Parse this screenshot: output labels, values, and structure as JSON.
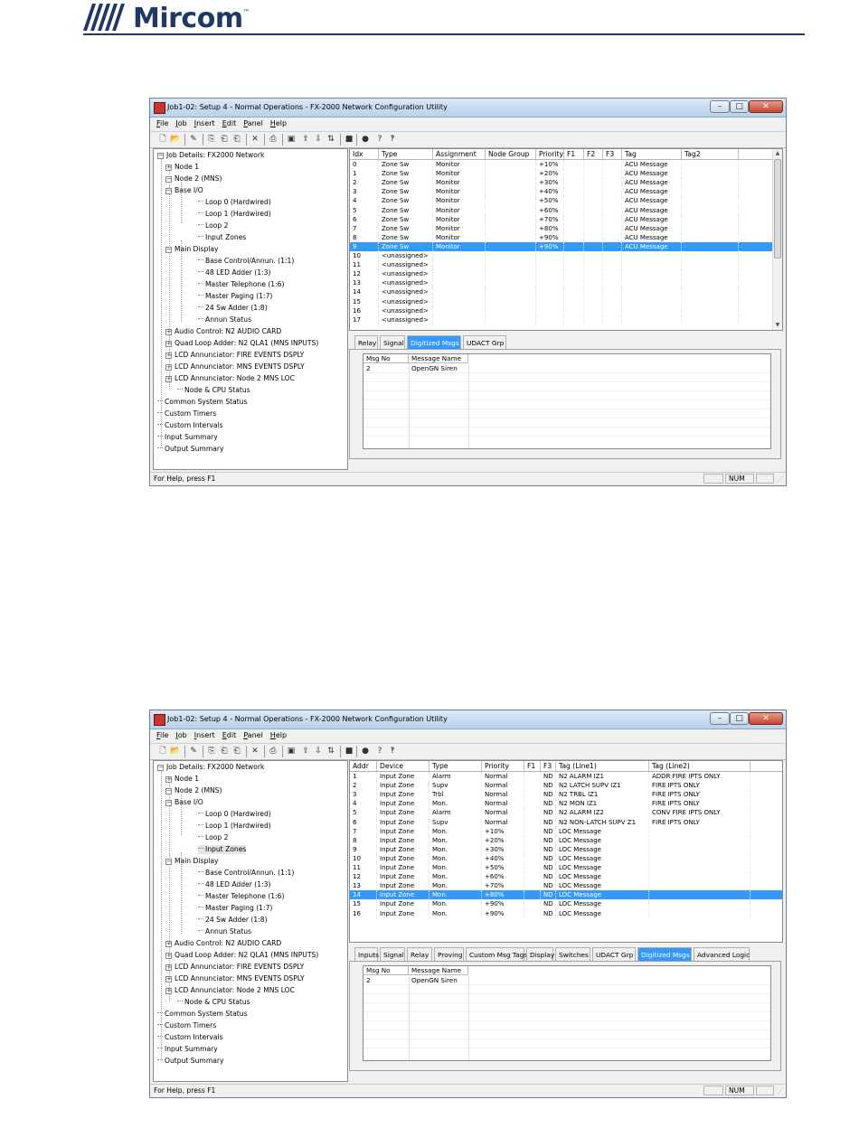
{
  "brand": {
    "name": "Mircom",
    "tm": "™",
    "color": "#1f3864"
  },
  "windows": [
    {
      "title": "Job1-02: Setup 4 - Normal Operations - FX-2000 Network Configuration Utility",
      "menu": [
        "File",
        "Job",
        "Insert",
        "Edit",
        "Panel",
        "Help"
      ],
      "tree": [
        "Job Details: FX2000 Network",
        "Node 1",
        "Node 2 (MNS)",
        "Base I/O",
        "Loop 0  (Hardwired)",
        "Loop 1  (Hardwired)",
        "Loop 2",
        "Input Zones",
        "Main Display",
        "Base Control/Annun. (1:1)",
        "48 LED Adder (1:3)",
        "Master Telephone (1:6)",
        "Master Paging (1:7)",
        "24 Sw Adder (1:8)",
        "Annun Status",
        "Audio Control: N2 AUDIO CARD",
        "Quad Loop Adder: N2 QLA1 (MNS INPUTS)",
        "LCD Annunciator: FIRE EVENTS DSPLY",
        "LCD Annunciator: MNS EVENTS DSPLY",
        "LCD Annunciator: Node 2 MNS LOC",
        "Node & CPU Status",
        "Common System Status",
        "Custom Timers",
        "Custom Intervals",
        "Input Summary",
        "Output Summary"
      ],
      "grid_headers": [
        "Idx",
        "Type",
        "Assignment",
        "Node Group",
        "Priority",
        "F1",
        "F2",
        "F3",
        "Tag",
        "Tag2"
      ],
      "grid_rows": [
        [
          "0",
          "Zone Sw",
          "Monitor",
          "",
          "+10%",
          "",
          "",
          "",
          "ACU Message",
          ""
        ],
        [
          "1",
          "Zone Sw",
          "Monitor",
          "",
          "+20%",
          "",
          "",
          "",
          "ACU Message",
          ""
        ],
        [
          "2",
          "Zone Sw",
          "Monitor",
          "",
          "+30%",
          "",
          "",
          "",
          "ACU Message",
          ""
        ],
        [
          "3",
          "Zone Sw",
          "Monitor",
          "",
          "+40%",
          "",
          "",
          "",
          "ACU Message",
          ""
        ],
        [
          "4",
          "Zone Sw",
          "Monitor",
          "",
          "+50%",
          "",
          "",
          "",
          "ACU Message",
          ""
        ],
        [
          "5",
          "Zone Sw",
          "Monitor",
          "",
          "+60%",
          "",
          "",
          "",
          "ACU Message",
          ""
        ],
        [
          "6",
          "Zone Sw",
          "Monitor",
          "",
          "+70%",
          "",
          "",
          "",
          "ACU Message",
          ""
        ],
        [
          "7",
          "Zone Sw",
          "Monitor",
          "",
          "+80%",
          "",
          "",
          "",
          "ACU Message",
          ""
        ],
        [
          "8",
          "Zone Sw",
          "Monitor",
          "",
          "+90%",
          "",
          "",
          "",
          "ACU Message",
          ""
        ],
        [
          "9",
          "Zone Sw",
          "Monitor",
          "",
          "+90%",
          "",
          "",
          "",
          "ACU Message",
          ""
        ],
        [
          "10",
          "<unassigned>",
          "",
          "",
          "",
          "",
          "",
          "",
          "",
          ""
        ],
        [
          "11",
          "<unassigned>",
          "",
          "",
          "",
          "",
          "",
          "",
          "",
          ""
        ],
        [
          "12",
          "<unassigned>",
          "",
          "",
          "",
          "",
          "",
          "",
          "",
          ""
        ],
        [
          "13",
          "<unassigned>",
          "",
          "",
          "",
          "",
          "",
          "",
          "",
          ""
        ],
        [
          "14",
          "<unassigned>",
          "",
          "",
          "",
          "",
          "",
          "",
          "",
          ""
        ],
        [
          "15",
          "<unassigned>",
          "",
          "",
          "",
          "",
          "",
          "",
          "",
          ""
        ],
        [
          "16",
          "<unassigned>",
          "",
          "",
          "",
          "",
          "",
          "",
          "",
          ""
        ],
        [
          "17",
          "<unassigned>",
          "",
          "",
          "",
          "",
          "",
          "",
          "",
          ""
        ]
      ],
      "selected_row": 9,
      "tabs": [
        "Relay",
        "Signal",
        "Digitized Msgs",
        "UDACT Grp"
      ],
      "active_tab": 2,
      "msg_headers": [
        "Msg No",
        "Message Name"
      ],
      "msg_rows": [
        [
          "2",
          "OpenGN Siren"
        ]
      ],
      "status": {
        "help": "For Help, press F1",
        "num": "NUM"
      }
    },
    {
      "title": "Job1-02: Setup 4 - Normal Operations - FX-2000 Network Configuration Utility",
      "menu": [
        "File",
        "Job",
        "Insert",
        "Edit",
        "Panel",
        "Help"
      ],
      "tree": [
        "Job Details: FX2000 Network",
        "Node 1",
        "Node 2 (MNS)",
        "Base I/O",
        "Loop 0  (Hardwired)",
        "Loop 1  (Hardwired)",
        "Loop 2",
        "Input Zones",
        "Main Display",
        "Base Control/Annun. (1:1)",
        "48 LED Adder (1:3)",
        "Master Telephone (1:6)",
        "Master Paging (1:7)",
        "24 Sw Adder (1:8)",
        "Annun Status",
        "Audio Control: N2 AUDIO CARD",
        "Quad Loop Adder: N2 QLA1 (MNS INPUTS)",
        "LCD Annunciator: FIRE EVENTS DSPLY",
        "LCD Annunciator: MNS EVENTS DSPLY",
        "LCD Annunciator: Node 2 MNS LOC",
        "Node & CPU Status",
        "Common System Status",
        "Custom Timers",
        "Custom Intervals",
        "Input Summary",
        "Output Summary"
      ],
      "grid_headers": [
        "Addr",
        "Device",
        "Type",
        "Priority",
        "F1",
        "F3",
        "Tag (Line1)",
        "Tag (Line2)"
      ],
      "grid_rows": [
        [
          "1",
          "Input Zone",
          "Alarm",
          "Normal",
          "",
          "ND",
          "N2 ALARM IZ1",
          "ADDR FIRE IPTS ONLY"
        ],
        [
          "2",
          "Input Zone",
          "Supv",
          "Normal",
          "",
          "ND",
          "N2 LATCH SUPV IZ1",
          "FIRE IPTS ONLY"
        ],
        [
          "3",
          "Input Zone",
          "Trbl",
          "Normal",
          "",
          "ND",
          "N2 TRBL IZ1",
          "FIRE IPTS ONLY"
        ],
        [
          "4",
          "Input Zone",
          "Mon.",
          "Normal",
          "",
          "ND",
          "N2 MON IZ1",
          "FIRE IPTS ONLY"
        ],
        [
          "5",
          "Input Zone",
          "Alarm",
          "Normal",
          "",
          "ND",
          "N2 ALARM IZ2",
          "CONV FIRE IPTS ONLY"
        ],
        [
          "6",
          "Input Zone",
          "Supv",
          "Normal",
          "",
          "ND",
          "N2 NON-LATCH SUPV Z1",
          "FIRE IPTS ONLY"
        ],
        [
          "7",
          "Input Zone",
          "Mon.",
          "+10%",
          "",
          "ND",
          "LOC Message",
          ""
        ],
        [
          "8",
          "Input Zone",
          "Mon.",
          "+20%",
          "",
          "ND",
          "LOC Message",
          ""
        ],
        [
          "9",
          "Input Zone",
          "Mon.",
          "+30%",
          "",
          "ND",
          "LOC Message",
          ""
        ],
        [
          "10",
          "Input Zone",
          "Mon.",
          "+40%",
          "",
          "ND",
          "LOC Message",
          ""
        ],
        [
          "11",
          "Input Zone",
          "Mon.",
          "+50%",
          "",
          "ND",
          "LOC Message",
          ""
        ],
        [
          "12",
          "Input Zone",
          "Mon.",
          "+60%",
          "",
          "ND",
          "LOC Message",
          ""
        ],
        [
          "13",
          "Input Zone",
          "Mon.",
          "+70%",
          "",
          "ND",
          "LOC Message",
          ""
        ],
        [
          "14",
          "Input Zone",
          "Mon.",
          "+80%",
          "",
          "ND",
          "LOC Message",
          ""
        ],
        [
          "15",
          "Input Zone",
          "Mon.",
          "+90%",
          "",
          "ND",
          "LOC Message",
          ""
        ],
        [
          "16",
          "Input Zone",
          "Mon.",
          "+90%",
          "",
          "ND",
          "LOC Message",
          ""
        ]
      ],
      "selected_row": 13,
      "tabs": [
        "Inputs",
        "Signal",
        "Relay",
        "Proving",
        "Custom Msg Tags",
        "Display",
        "Switches",
        "UDACT Grp",
        "Digitized Msgs",
        "Advanced Logic"
      ],
      "active_tab": 8,
      "msg_headers": [
        "Msg No",
        "Message Name"
      ],
      "msg_rows": [
        [
          "2",
          "OpenGN Siren"
        ]
      ],
      "status": {
        "help": "For Help, press F1",
        "num": "NUM"
      }
    }
  ]
}
